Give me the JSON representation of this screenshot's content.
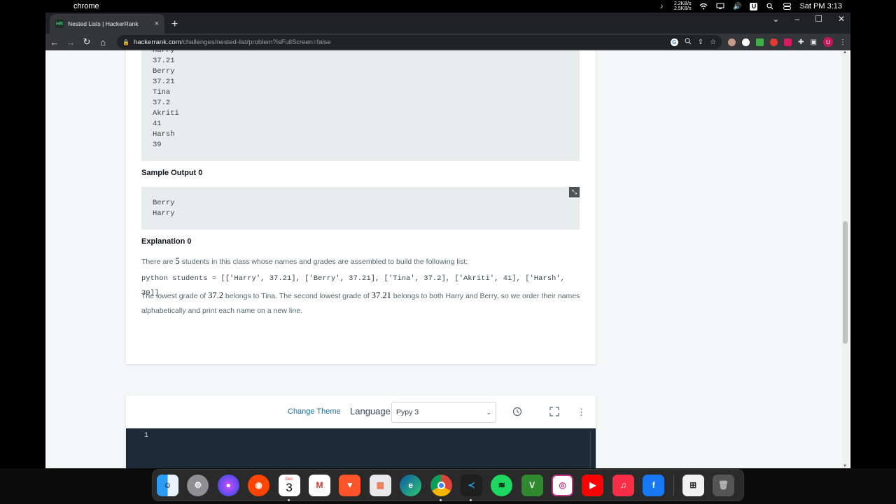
{
  "menubar": {
    "app_name": "chrome",
    "net_up": "2.2KB/s",
    "net_down": "2.5KB/s",
    "user_badge": "U",
    "clock": "Sat PM 3:13"
  },
  "browser": {
    "tab_title": "Nested Lists | HackerRank",
    "tab_favicon": "HR",
    "url_host": "hackerrank.com",
    "url_path": "/challenges/nested-list/problem?isFullScreen=false",
    "profile_initial": "U"
  },
  "problem": {
    "sample_input_lines": [
      "Harry",
      "37.21",
      "Berry",
      "37.21",
      "Tina",
      "37.2",
      "Akriti",
      "41",
      "Harsh",
      "39"
    ],
    "sample_output_heading": "Sample Output 0",
    "sample_output_lines": [
      "Berry",
      "Harry"
    ],
    "explanation_heading": "Explanation 0",
    "explanation_p1_before": "There are ",
    "explanation_p1_num": "5",
    "explanation_p1_after": " students in this class whose names and grades are assembled to build the following list:",
    "code_line": "python students = [['Harry', 37.21], ['Berry', 37.21], ['Tina', 37.2], ['Akriti', 41], ['Harsh', 39]]",
    "explanation_p3_a": "The lowest grade of ",
    "explanation_p3_num1": "37.2",
    "explanation_p3_b": " belongs to Tina. The second lowest grade of ",
    "explanation_p3_num2": "37.21",
    "explanation_p3_c": " belongs to both Harry and Berry, so we order their names alphabetically and print each name on a new line."
  },
  "editor": {
    "change_theme": "Change Theme",
    "language_label": "Language",
    "language_value": "Pypy 3",
    "line_number": "1"
  },
  "dock": {
    "calendar_month": "Dec",
    "calendar_day": "3",
    "icons": [
      "finder-icon",
      "system-preferences-icon",
      "siri-icon",
      "reddit-icon",
      "calendar-icon",
      "gmail-icon",
      "brave-icon",
      "launchpad-icon",
      "edge-icon",
      "chrome-icon",
      "vscode-icon",
      "spotify-icon",
      "vim-icon",
      "instagram-icon",
      "youtube-icon",
      "music-icon",
      "facebook-icon",
      "windows-icon",
      "trash-icon"
    ]
  }
}
